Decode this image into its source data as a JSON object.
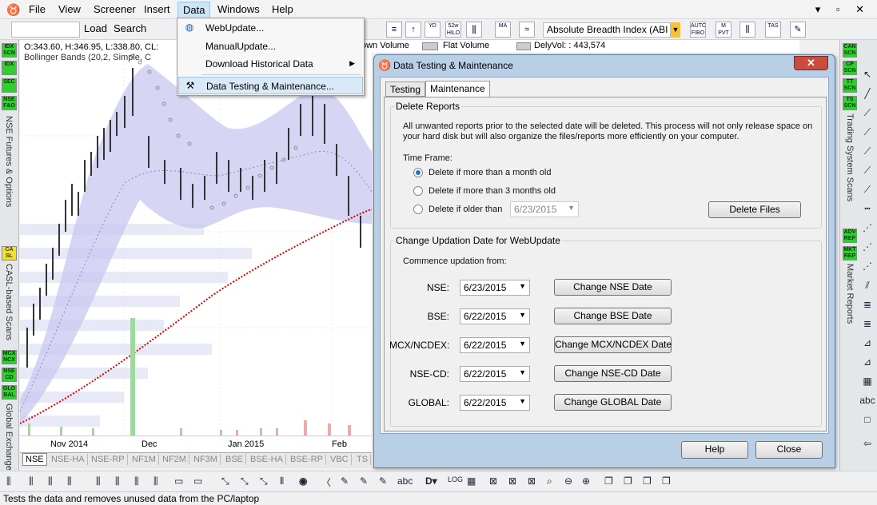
{
  "menubar": {
    "items": [
      "File",
      "View",
      "Screener",
      "Insert",
      "Data",
      "Windows",
      "Help"
    ],
    "win_controls": "▾ ▫ ✕"
  },
  "toolbar": {
    "load": "Load",
    "search": "Search",
    "indicator": "Absolute Breadth Index (ABI",
    "icons": [
      "52w HILO",
      "MA",
      "AUTO FIBO",
      "M PVT",
      "TAS"
    ]
  },
  "chart": {
    "ohlc": "O:343.60, H:346.95, L:338.80, CL:",
    "overlay": "Bollinger Bands (20,2, Simple, C",
    "x_labels": [
      "Nov 2014",
      "Dec",
      "Jan 2015",
      "Feb"
    ],
    "volume_items": [
      "own Volume",
      "Flat Volume",
      "DelyVol: : 443,574"
    ],
    "colors": {
      "band": "#c8c8f0",
      "ma": "#dd0000",
      "volume": "#99dd99"
    }
  },
  "sheets": [
    "NSE",
    "NSE-HA",
    "NSE-RP",
    "NF1M",
    "NF2M",
    "NF3M",
    "BSE",
    "BSE-HA",
    "BSE-RP",
    "VBC",
    "TS"
  ],
  "left_sidebar": {
    "icons": [
      "IDX SCN",
      "IDX",
      "SEC",
      "NSE F&O",
      "CA SL",
      "MCX NCX",
      "NSE CD",
      "GLO BAL"
    ],
    "labels": [
      "NSE Futures & Options",
      "CASL-based Scans",
      "Global Exchanges"
    ]
  },
  "right_sidebar": {
    "icons": [
      "CAN SCN",
      "CP SCN",
      "TT SCN",
      "TS SCN",
      "ADV REP",
      "MKT REP"
    ],
    "labels": [
      "Trading System Scans",
      "Market Reports"
    ]
  },
  "dropdown": {
    "items": [
      "WebUpdate...",
      "ManualUpdate...",
      "Download Historical Data",
      "Data Testing & Maintenance..."
    ]
  },
  "dialog": {
    "title": "Data Testing & Maintenance",
    "tabs": [
      "Testing",
      "Maintenance"
    ],
    "delete_reports": {
      "legend": "Delete Reports",
      "description_1": "All unwanted reports prior to the selected date will be deleted. This process will not only release space on",
      "description_2": "your hard disk but will also organize the files/reports more efficiently on your computer.",
      "time_frame": "Time Frame:",
      "options": [
        "Delete if more than a month old",
        "Delete if more than 3 months old",
        "Delete if older than"
      ],
      "selected_option": 0,
      "date": "6/23/2015",
      "delete_button": "Delete Files"
    },
    "updation": {
      "legend": "Change Updation Date for WebUpdate",
      "commence": "Commence updation from:",
      "rows": [
        {
          "label": "NSE:",
          "date": "6/23/2015",
          "button": "Change NSE Date"
        },
        {
          "label": "BSE:",
          "date": "6/22/2015",
          "button": "Change BSE Date"
        },
        {
          "label": "MCX/NCDEX:",
          "date": "6/22/2015",
          "button": "Change MCX/NCDEX Date"
        },
        {
          "label": "NSE-CD:",
          "date": "6/22/2015",
          "button": "Change NSE-CD Date"
        },
        {
          "label": "GLOBAL:",
          "date": "6/22/2015",
          "button": "Change GLOBAL Date"
        }
      ]
    },
    "help": "Help",
    "close": "Close"
  },
  "status": "Tests the data and removes unused data from the PC/laptop"
}
